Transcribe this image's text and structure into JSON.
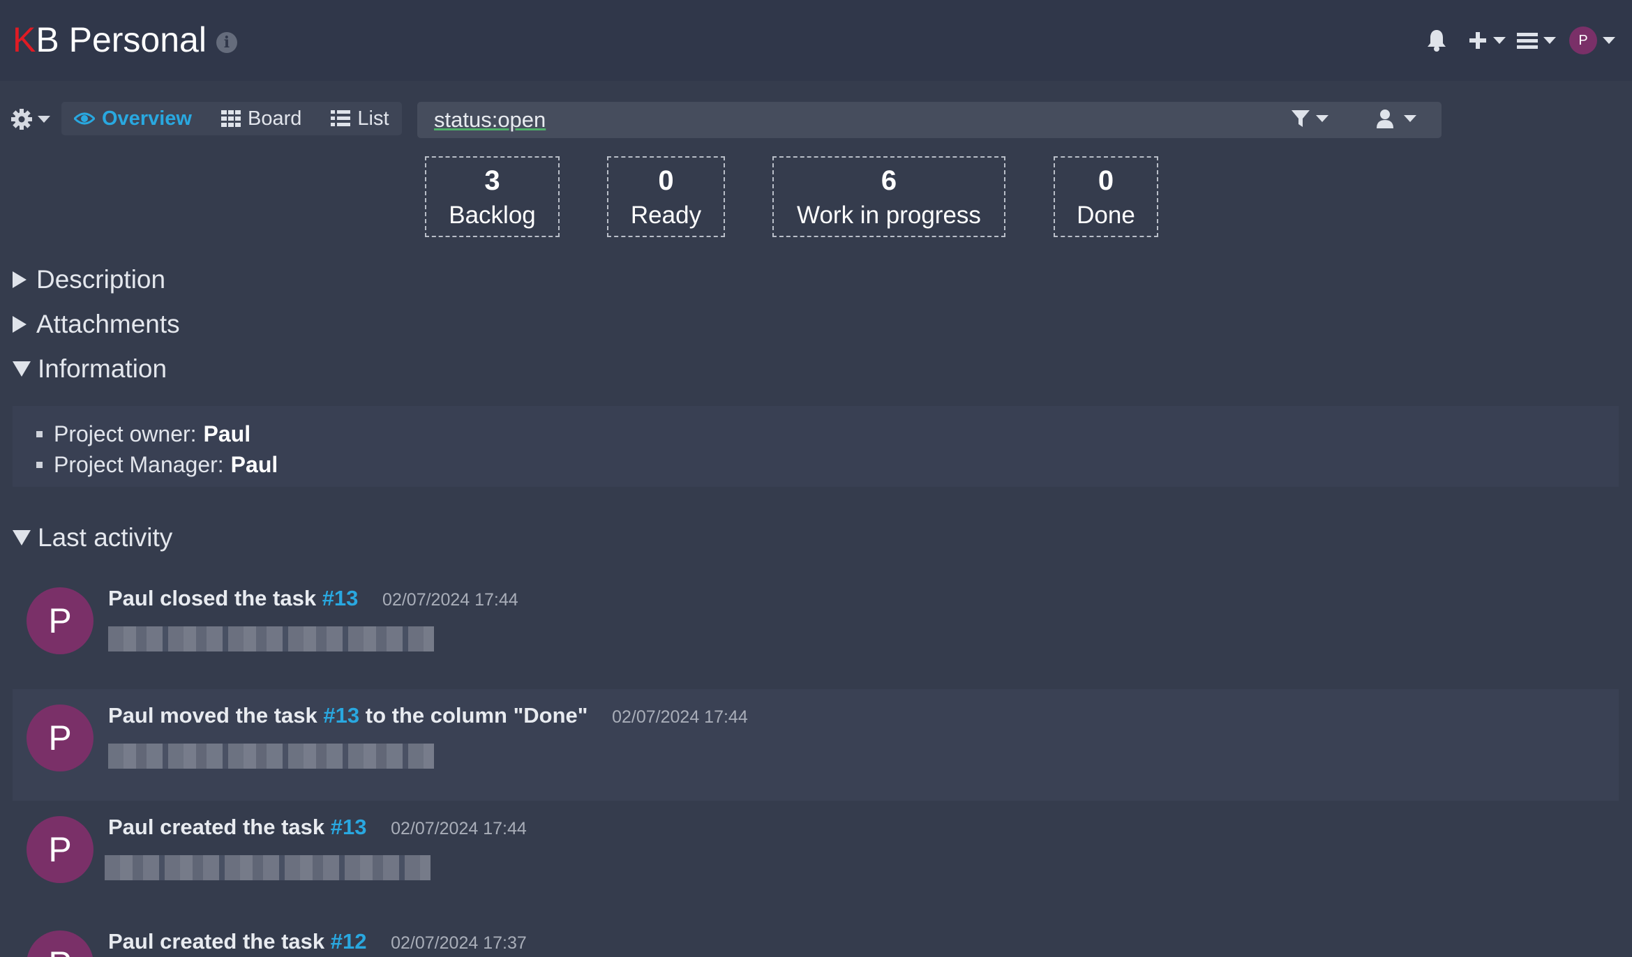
{
  "header": {
    "logo_k": "K",
    "logo_b": "B",
    "project_name": "Personal",
    "user_initial": "P"
  },
  "toolbar": {
    "views": [
      {
        "label": "Overview",
        "icon": "eye-icon",
        "active": true
      },
      {
        "label": "Board",
        "icon": "grid-icon",
        "active": false
      },
      {
        "label": "List",
        "icon": "list-icon",
        "active": false
      }
    ],
    "filter": {
      "value": "status:open"
    }
  },
  "counters": [
    {
      "count": "3",
      "label": "Backlog"
    },
    {
      "count": "0",
      "label": "Ready"
    },
    {
      "count": "6",
      "label": "Work in progress"
    },
    {
      "count": "0",
      "label": "Done"
    }
  ],
  "sections": {
    "description": "Description",
    "attachments": "Attachments",
    "information": "Information",
    "last_activity": "Last activity"
  },
  "information": {
    "owner_label": "Project owner:",
    "owner_value": "Paul",
    "manager_label": "Project Manager:",
    "manager_value": "Paul"
  },
  "activity": [
    {
      "initial": "P",
      "text_before": "Paul closed the task",
      "task": "#13",
      "text_after": "",
      "date": "02/07/2024 17:44"
    },
    {
      "initial": "P",
      "text_before": "Paul moved the task",
      "task": "#13",
      "text_after": "to the column \"Done\"",
      "date": "02/07/2024 17:44"
    },
    {
      "initial": "P",
      "text_before": "Paul created the task",
      "task": "#13",
      "text_after": "",
      "date": "02/07/2024 17:44"
    },
    {
      "initial": "P",
      "text_before": "Paul created the task",
      "task": "#12",
      "text_after": "",
      "date": "02/07/2024 17:37"
    }
  ],
  "colors": {
    "background": "#353c4d",
    "header": "#30374a",
    "accent": "#29a8e0",
    "logo_k": "#e01b24",
    "avatar": "#7a3068"
  }
}
